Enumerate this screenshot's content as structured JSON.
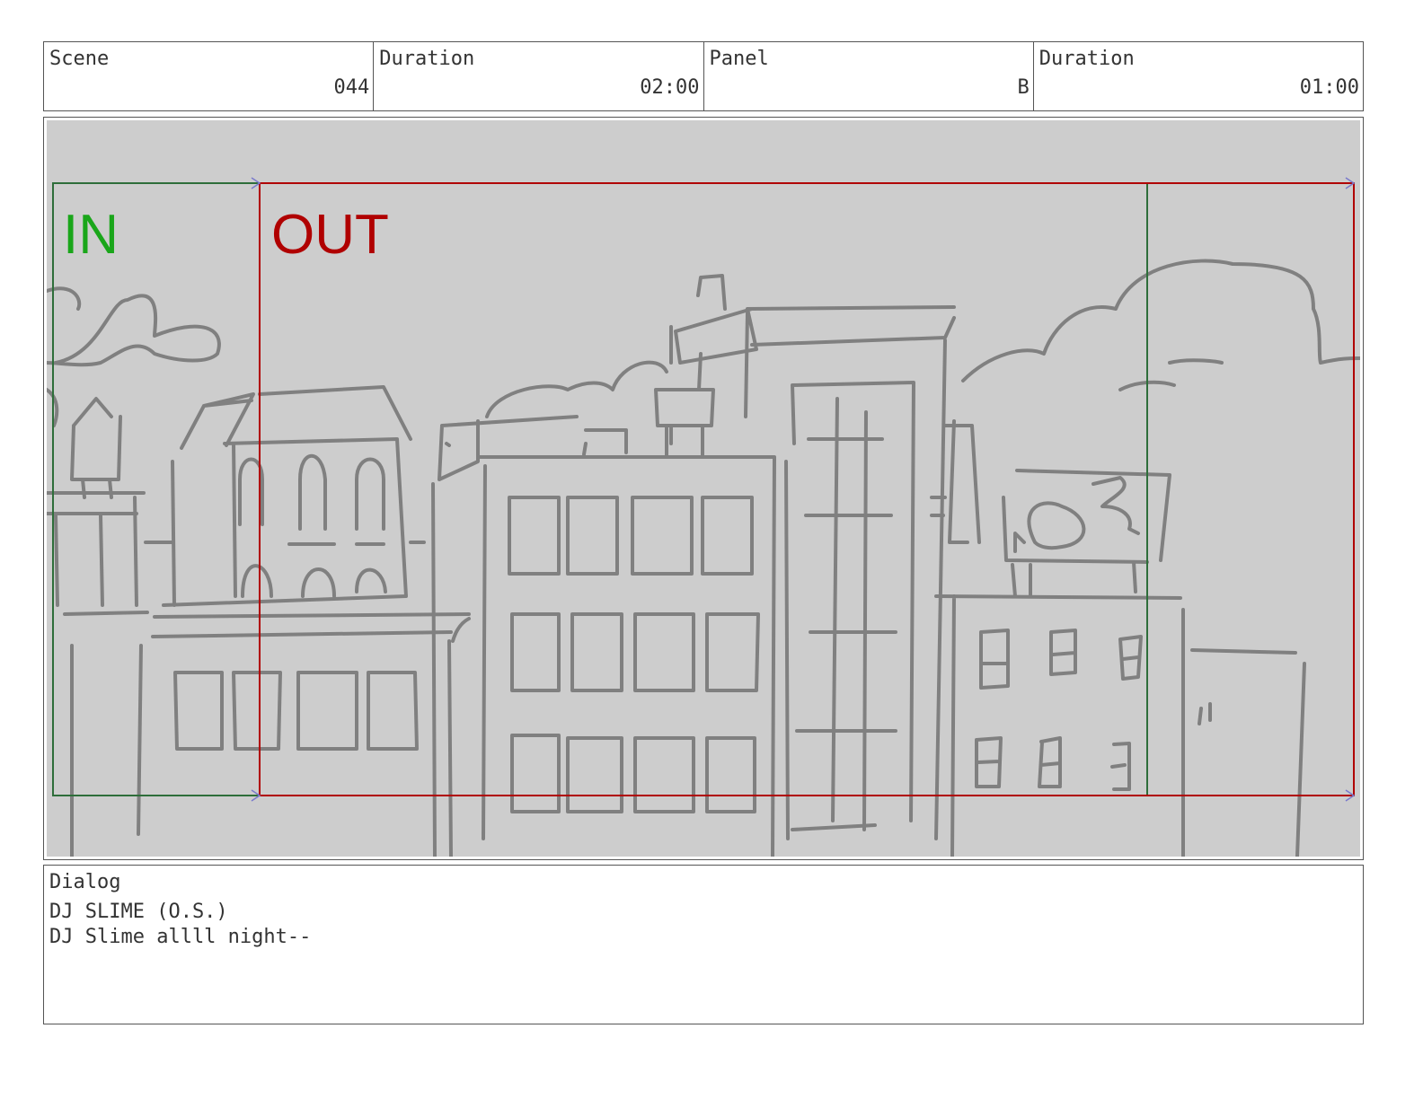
{
  "header": {
    "scene_label": "Scene",
    "scene_value": "044",
    "duration_label": "Duration",
    "duration_value": "02:00",
    "panel_label": "Panel",
    "panel_value": "B",
    "panel_duration_label": "Duration",
    "panel_duration_value": "01:00"
  },
  "frame": {
    "in_label": "IN",
    "out_label": "OUT",
    "in_color": "#1aa61a",
    "out_color": "#b00000",
    "background": "#cdcdcd",
    "sketch_color": "#808080"
  },
  "dialog": {
    "label": "Dialog",
    "lines": [
      "DJ SLIME (O.S.)",
      "DJ Slime allll night--"
    ]
  }
}
